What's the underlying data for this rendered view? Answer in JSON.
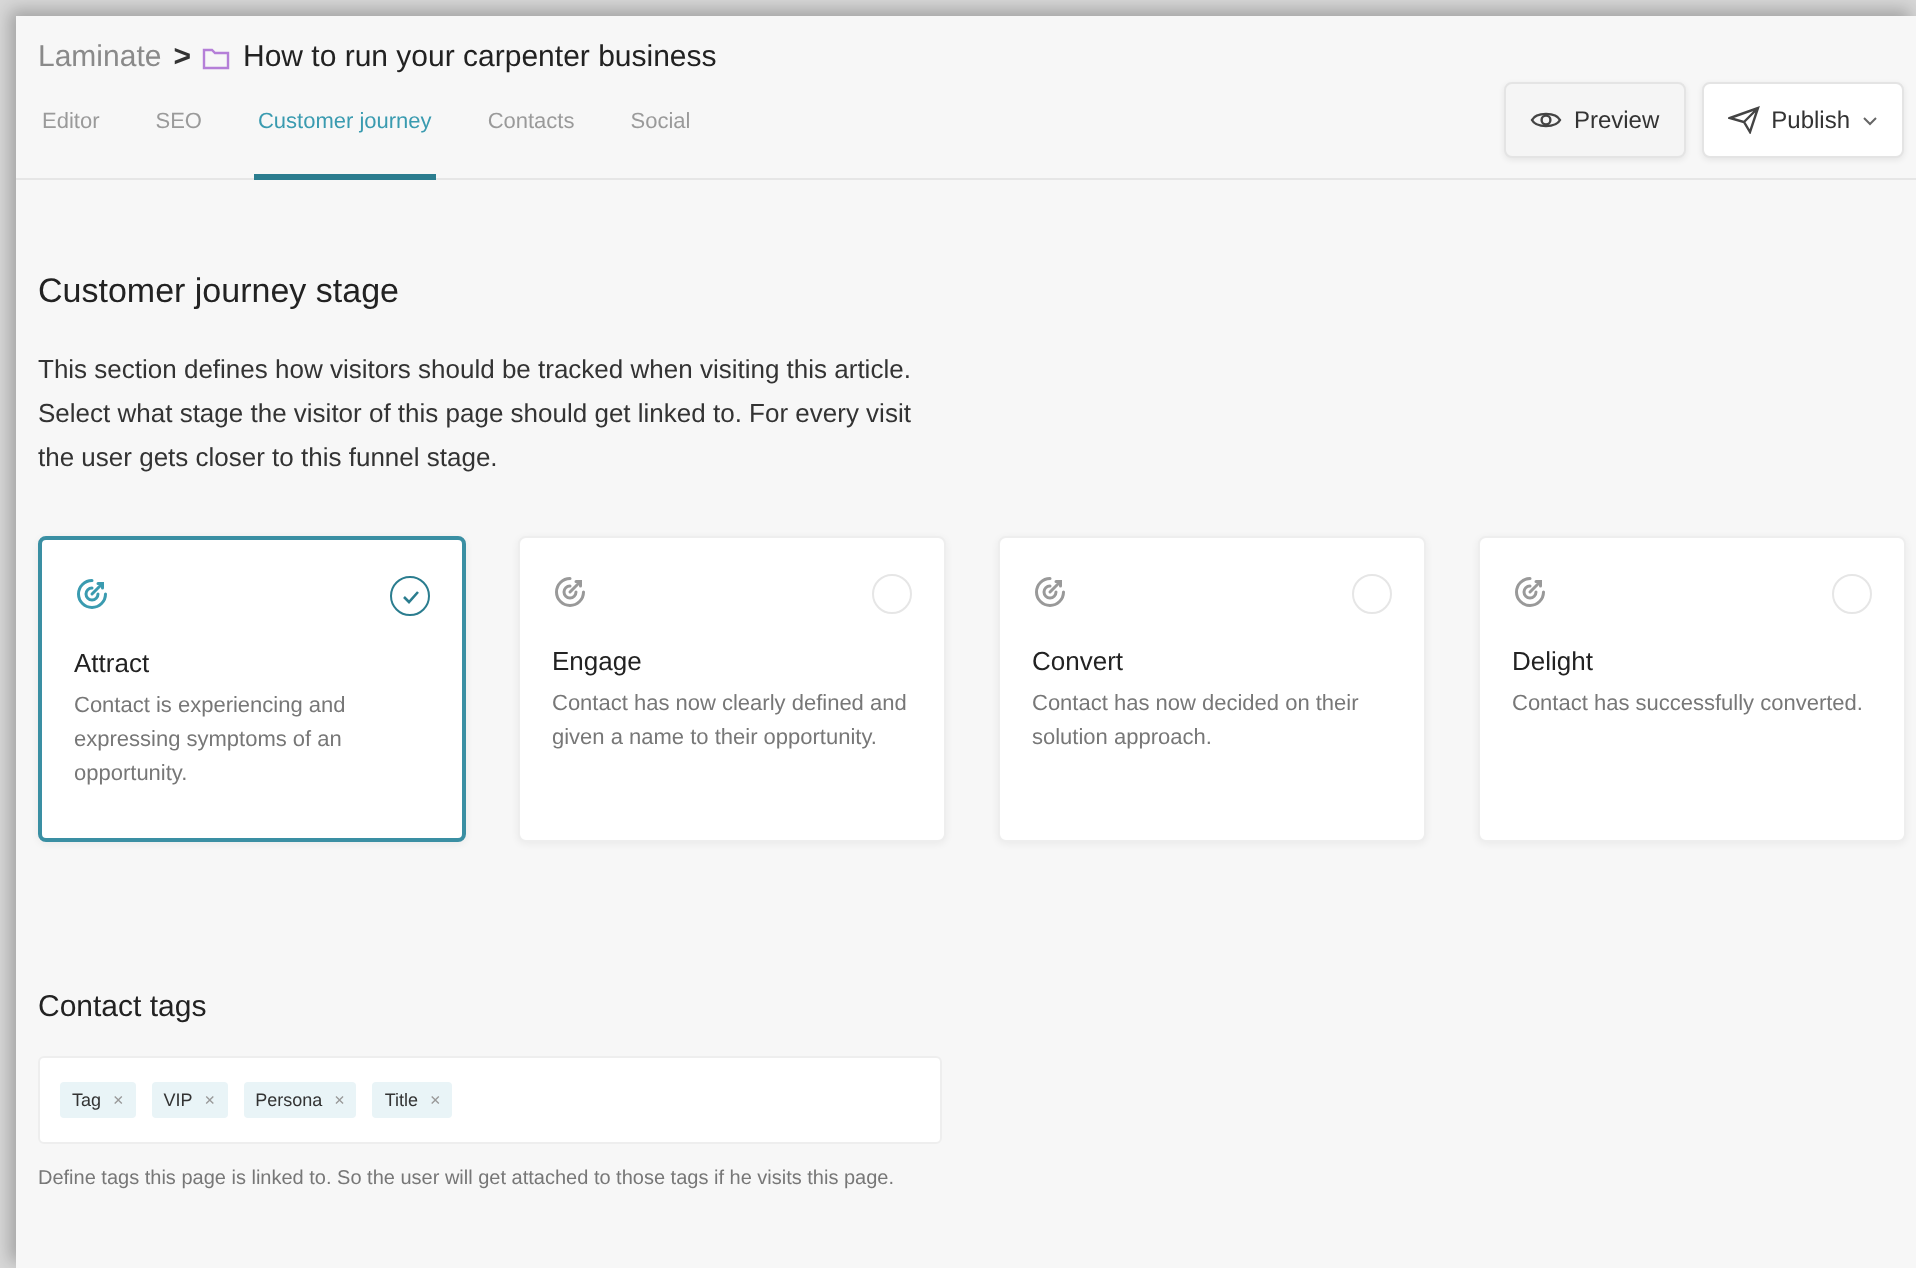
{
  "breadcrumb": {
    "parent": "Laminate",
    "separator": ">",
    "current": "How to run your carpenter business"
  },
  "tabs": [
    {
      "label": "Editor",
      "selected": false
    },
    {
      "label": "SEO",
      "selected": false
    },
    {
      "label": "Customer journey",
      "selected": true
    },
    {
      "label": "Contacts",
      "selected": false
    },
    {
      "label": "Social",
      "selected": false
    }
  ],
  "actions": {
    "preview": "Preview",
    "publish": "Publish"
  },
  "stage_section": {
    "title": "Customer journey stage",
    "description": "This section defines how visitors should be tracked when visiting this article. Select what stage the visitor of this page should get linked to. For every visit the user gets closer to this funnel stage.",
    "stages": [
      {
        "name": "Attract",
        "description": "Contact is experiencing and expressing symptoms of an opportunity.",
        "selected": true
      },
      {
        "name": "Engage",
        "description": "Contact has now clearly defined and given a name to their opportunity.",
        "selected": false
      },
      {
        "name": "Convert",
        "description": "Contact has now decided on their solution approach.",
        "selected": false
      },
      {
        "name": "Delight",
        "description": "Contact has successfully converted.",
        "selected": false
      }
    ]
  },
  "tags_section": {
    "title": "Contact tags",
    "tags": [
      {
        "label": "Tag",
        "remove": "×"
      },
      {
        "label": "VIP",
        "remove": "×"
      },
      {
        "label": "Persona",
        "remove": "×"
      },
      {
        "label": "Title",
        "remove": "×"
      }
    ],
    "help": "Define tags this page is linked to. So the user will get attached to those tags if he visits this page."
  }
}
